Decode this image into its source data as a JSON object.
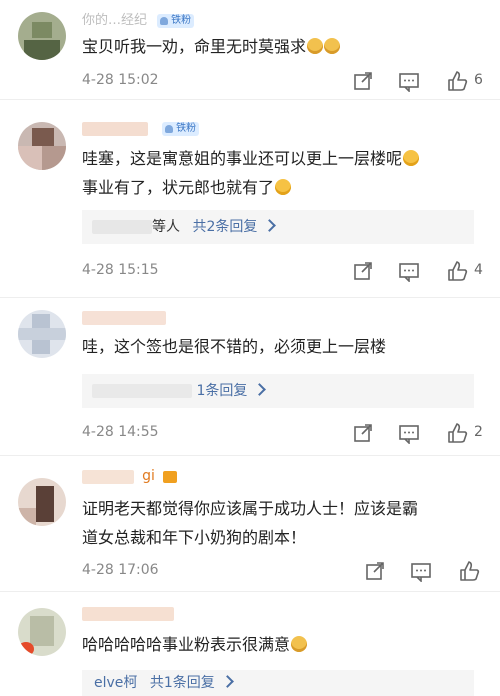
{
  "comments": [
    {
      "username_partial": "你的…经纪",
      "badge": "铁粉",
      "text_lines": [
        "宝贝听我一劝，命里无时莫强求"
      ],
      "emoji": [
        "cat-icon",
        "cat-icon"
      ],
      "time": "4-28 15:02",
      "likes": "6",
      "replies": null
    },
    {
      "username_partial": "",
      "badge": "铁粉",
      "text_lines": [
        "哇塞，这是寓意姐的事业还可以更上一层楼呢",
        "事业有了，状元郎也就有了"
      ],
      "time": "4-28 15:15",
      "likes": "4",
      "replies": {
        "prefix": "等人",
        "link": "共2条回复"
      }
    },
    {
      "username_partial": "",
      "badge": "",
      "text_lines": [
        "哇，这个签也是很不错的，必须更上一层楼"
      ],
      "time": "4-28 14:55",
      "likes": "2",
      "replies": {
        "prefix": "",
        "link": "1条回复"
      }
    },
    {
      "username_partial": "gi",
      "badge": "",
      "text_lines": [
        "证明老天都觉得你应该属于成功人士！应该是霸",
        "道女总裁和年下小奶狗的剧本！"
      ],
      "time": "4-28 17:06",
      "likes": "",
      "replies": null
    },
    {
      "username_partial": "",
      "badge": "",
      "text_lines": [
        "哈哈哈哈哈事业粉表示很满意"
      ],
      "time": "",
      "likes": "",
      "replies": {
        "prefix": "elve柯",
        "link": "共1条回复"
      }
    }
  ],
  "colors": {
    "link": "#4a6fa5",
    "meta": "#888888",
    "reply_bg": "#f5f5f5"
  }
}
